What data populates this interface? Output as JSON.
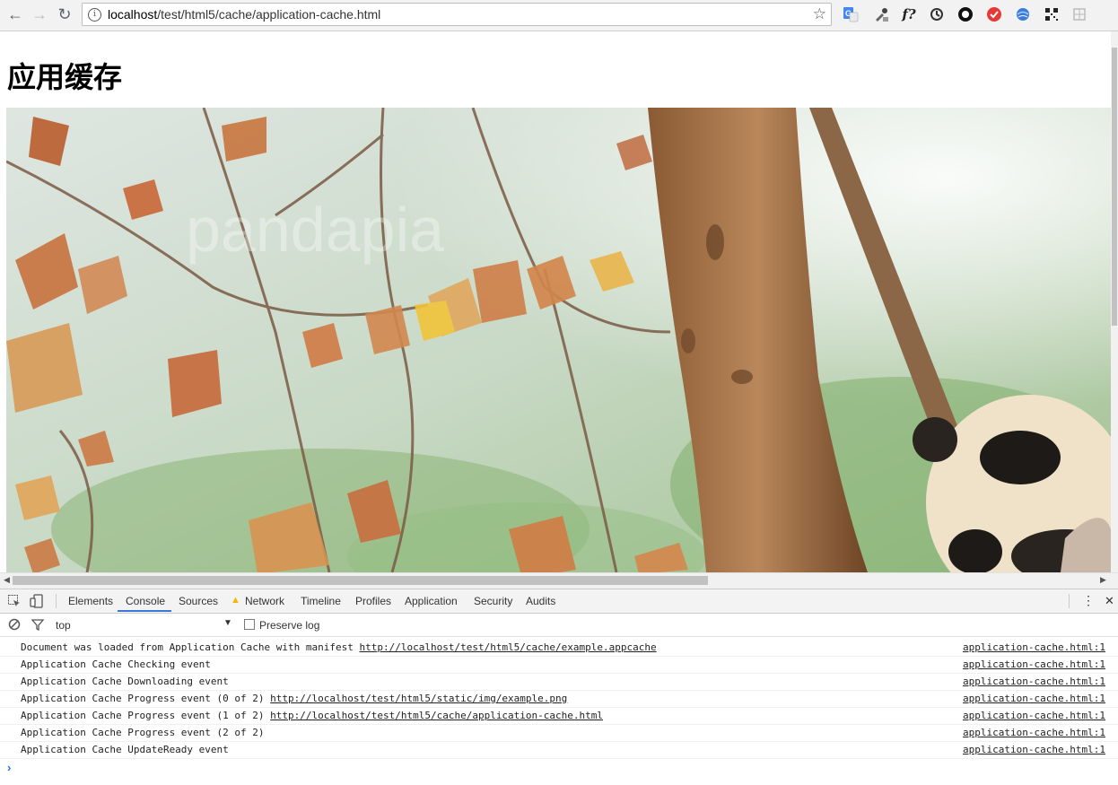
{
  "browser": {
    "back_glyph": "←",
    "forward_glyph": "→",
    "reload_glyph": "↻",
    "url_host": "localhost",
    "url_path": "/test/html5/cache/application-cache.html",
    "star_glyph": "☆",
    "extensions": [
      "translate-icon",
      "eyedropper-icon",
      "font-icon",
      "sync-icon",
      "circle-icon",
      "check-icon",
      "globe-icon",
      "qr-icon",
      "puzzle-icon"
    ]
  },
  "page": {
    "heading": "应用缓存"
  },
  "devtools": {
    "tabs": [
      "Elements",
      "Console",
      "Sources",
      "Network",
      "Timeline",
      "Profiles",
      "Application",
      "Security",
      "Audits"
    ],
    "active_tab": "Console",
    "context": "top",
    "preserve_log_label": "Preserve log",
    "menu_glyph": "⋮",
    "close_glyph": "✕",
    "messages": [
      {
        "text": "Document was loaded from Application Cache with manifest ",
        "link": "http://localhost/test/html5/cache/example.appcache",
        "source": "application-cache.html:1"
      },
      {
        "text": "Application Cache Checking event",
        "link": "",
        "source": "application-cache.html:1"
      },
      {
        "text": "Application Cache Downloading event",
        "link": "",
        "source": "application-cache.html:1"
      },
      {
        "text": "Application Cache Progress event (0 of 2) ",
        "link": "http://localhost/test/html5/static/img/example.png",
        "source": "application-cache.html:1"
      },
      {
        "text": "Application Cache Progress event (1 of 2) ",
        "link": "http://localhost/test/html5/cache/application-cache.html",
        "source": "application-cache.html:1"
      },
      {
        "text": "Application Cache Progress event (2 of 2)",
        "link": "",
        "source": "application-cache.html:1"
      },
      {
        "text": "Application Cache UpdateReady event",
        "link": "",
        "source": "application-cache.html:1"
      }
    ],
    "prompt_glyph": "›"
  },
  "colors": {
    "accent": "#3879d9",
    "warning": "#f4b400",
    "link": "#222222"
  }
}
